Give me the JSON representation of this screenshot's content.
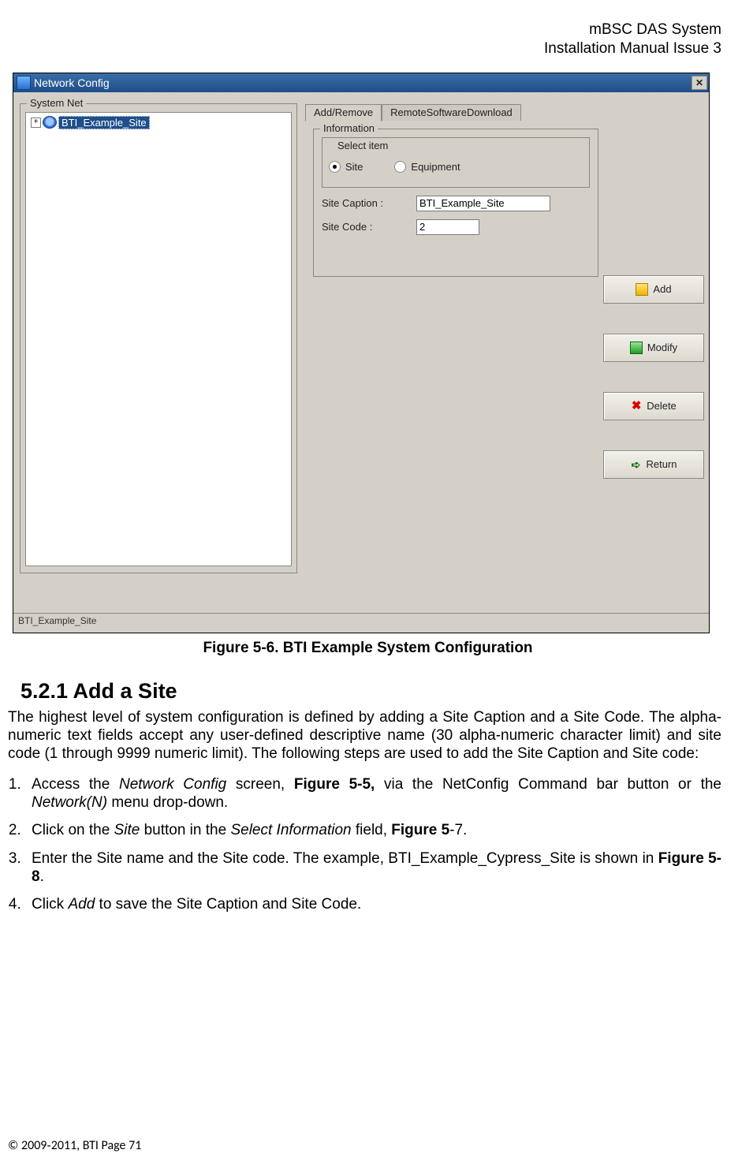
{
  "header": {
    "line1": "mBSC DAS System",
    "line2": "Installation Manual Issue 3"
  },
  "dialog": {
    "title": "Network Config",
    "systemNetLabel": "System Net",
    "tree": {
      "expander": "+",
      "selected": "BTI_Example_Site"
    },
    "tabs": {
      "active": "Add/Remove",
      "inactive": "RemoteSoftwareDownload"
    },
    "info": {
      "groupLabel": "Information",
      "selectItemLabel": "Select item",
      "siteRadioLabel": "Site",
      "equipRadioLabel": "Equipment",
      "siteCaptionLabel": "Site Caption :",
      "siteCaptionValue": "BTI_Example_Site",
      "siteCodeLabel": "Site Code :",
      "siteCodeValue": "2"
    },
    "buttons": {
      "add": "Add",
      "modify": "Modify",
      "delete": "Delete",
      "return": "Return"
    },
    "status": "BTI_Example_Site"
  },
  "figureCaption": "Figure 5-6. BTI Example System Configuration",
  "sectionHeading": "5.2.1  Add a Site",
  "para1": "The highest level of system configuration is defined by adding a Site Caption and a Site Code. The alpha-numeric text fields accept any user-defined descriptive name (30 alpha-numeric character limit) and site code (1 through 9999 numeric limit). The following steps are used to add the Site Caption and Site code:",
  "steps": {
    "s1a": "Access the ",
    "s1b": "Network Config",
    "s1c": " screen, ",
    "s1d": "Figure 5-5,",
    "s1e": " via the NetConfig Command bar button or the ",
    "s1f": "Network(N)",
    "s1g": " menu drop-down.",
    "s2a": "Click on the ",
    "s2b": "Site",
    "s2c": " button in the ",
    "s2d": "Select Information",
    "s2e": " field, ",
    "s2f": "Figure 5",
    "s2g": "-7.",
    "s3a": "Enter the Site name and the Site code. The example, BTI_Example_Cypress_Site is shown in ",
    "s3b": "Figure 5-8",
    "s3c": ".",
    "s4a": "Click ",
    "s4b": "Add",
    "s4c": " to save the Site Caption and Site Code."
  },
  "footer": {
    "copyright": "© 2009‑2011, BTI Page ",
    "pageNo": "71"
  }
}
